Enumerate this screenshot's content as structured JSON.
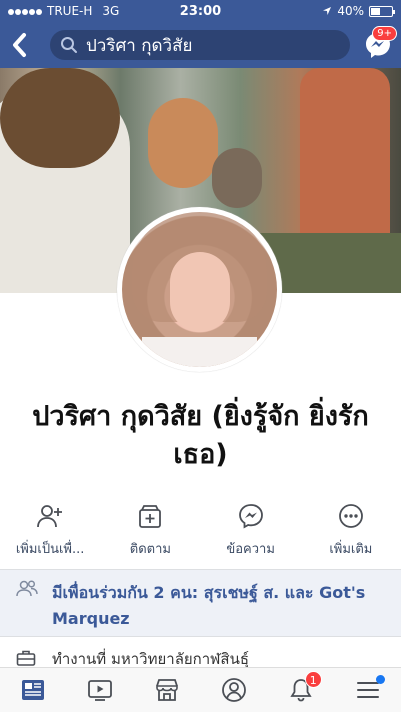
{
  "status_bar": {
    "carrier": "TRUE-H",
    "network": "3G",
    "time": "23:00",
    "battery": "40%"
  },
  "nav": {
    "search_text": "ปวริศา กุดวิสัย",
    "messenger_badge": "9+"
  },
  "profile": {
    "name": "ปวริศา กุดวิสัย (ยิ่งรู้จัก ยิ่งรักเธอ)"
  },
  "actions": [
    {
      "label": "เพิ่มเป็นเพื่...",
      "icon": "add-friend-icon"
    },
    {
      "label": "ติดตาม",
      "icon": "follow-icon"
    },
    {
      "label": "ข้อความ",
      "icon": "messenger-icon"
    },
    {
      "label": "เพิ่มเติม",
      "icon": "more-icon"
    }
  ],
  "mutual": {
    "text": "มีเพื่อนร่วมกัน 2 คน: สุรเชษฐ์ ส. และ Got's Marquez"
  },
  "work": {
    "text": "ทำงานที่ มหาวิทยาลัยกาฬสินธุ์"
  },
  "tabbar": {
    "notifications_badge": "1"
  },
  "colors": {
    "brand": "#3b5998",
    "badge": "#fa3e3e"
  }
}
